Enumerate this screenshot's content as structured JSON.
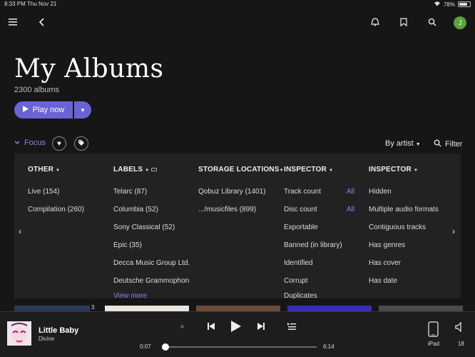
{
  "status": {
    "time": "8:33 PM",
    "date": "Thu Nov 21",
    "battery": "78%"
  },
  "header": {
    "avatar_letter": "J"
  },
  "page": {
    "title": "My Albums",
    "count": "2300 albums",
    "play_label": "Play now"
  },
  "toolbar": {
    "focus_label": "Focus",
    "sort_label": "By artist",
    "filter_label": "Filter"
  },
  "columns": [
    {
      "header": "OTHER",
      "items": [
        "Live (154)",
        "Compilation (260)"
      ]
    },
    {
      "header": "LABELS",
      "items": [
        "Telarc (87)",
        "Columbia (52)",
        "Sony Classical (52)",
        "Epic (35)",
        "Decca Music Group Ltd.",
        "Deutsche Grammophon"
      ],
      "more": "View more"
    },
    {
      "header": "STORAGE LOCATIONS",
      "items": [
        "Qobuz Library (1401)",
        ".../musicfiles (899)"
      ]
    },
    {
      "header": "INSPECTOR",
      "items": [
        "Track count",
        "Disc count",
        "Exportable",
        "Banned (in library)",
        "Identified",
        "Corrupt",
        "Duplicates"
      ],
      "all_label": "All"
    },
    {
      "header": "INSPECTOR",
      "items": [
        "Hidden",
        "Multiple audio formats",
        "Contiguous tracks",
        "Has genres",
        "Has cover",
        "Has date"
      ]
    }
  ],
  "thumb_badge": "3",
  "player": {
    "title": "Little Baby",
    "artist": "Divine",
    "elapsed": "0:07",
    "duration": "6:14",
    "device": "iPad",
    "volume": "18",
    "progress": 0.02
  }
}
